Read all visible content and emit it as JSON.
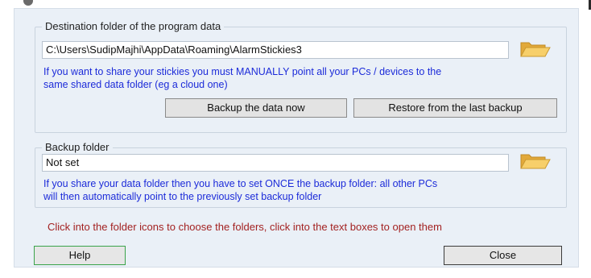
{
  "destination": {
    "group_title": "Destination folder of the program data",
    "path_value": "C:\\Users\\SudipMajhi\\AppData\\Roaming\\AlarmStickies3",
    "info_line1": "If you want to share your stickies you must MANUALLY point all your PCs / devices to the",
    "info_line2": "same shared data folder (eg a cloud one)",
    "backup_button_label": "Backup the data now",
    "restore_button_label": "Restore from the last backup",
    "folder_icon": "folder-icon"
  },
  "backup": {
    "group_title": "Backup folder",
    "path_value": "Not set",
    "info_line1": "If you share your data folder then you have to set ONCE the backup folder: all other PCs",
    "info_line2": "will then automatically point to the previously set backup folder",
    "folder_icon": "folder-icon"
  },
  "hint": "Click into the folder icons to choose the folders, click into the text boxes to open them",
  "footer": {
    "help_label": "Help",
    "close_label": "Close"
  },
  "colors": {
    "dialog_background": "#eaf0f7",
    "info_text": "#1c2bd9",
    "hint_text": "#a32222",
    "help_border": "#3aa34a",
    "folder_yellow": "#f3c35a"
  }
}
